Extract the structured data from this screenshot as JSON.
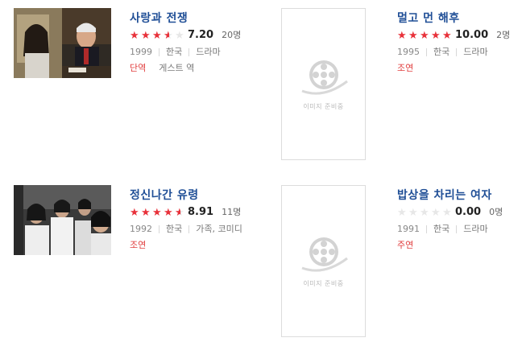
{
  "filmography": [
    {
      "title": "사랑과 전쟁",
      "stars": [
        1,
        1,
        1,
        0.5,
        0
      ],
      "score": "7.20",
      "count": "20명",
      "year": "1999",
      "country": "한국",
      "genre": "드라마",
      "role": "단역",
      "role_extra": "게스트 역",
      "has_image": true
    },
    {
      "title": "멀고 먼 해후",
      "stars": [
        1,
        1,
        1,
        1,
        1
      ],
      "score": "10.00",
      "count": "2명",
      "year": "1995",
      "country": "한국",
      "genre": "드라마",
      "role": "조연",
      "role_extra": "",
      "has_image": false
    },
    {
      "title": "정신나간 유령",
      "stars": [
        1,
        1,
        1,
        1,
        0.5
      ],
      "score": "8.91",
      "count": "11명",
      "year": "1992",
      "country": "한국",
      "genre": "가족, 코미디",
      "role": "조연",
      "role_extra": "",
      "has_image": true
    },
    {
      "title": "밥상을 차리는 여자",
      "stars": [
        0,
        0,
        0,
        0,
        0
      ],
      "score": "0.00",
      "count": "0명",
      "year": "1991",
      "country": "한국",
      "genre": "드라마",
      "role": "주연",
      "role_extra": "",
      "has_image": false
    }
  ],
  "placeholder_text": "이미지 준비중",
  "colors": {
    "title": "#1f4e96",
    "star_on": "#e8313a",
    "star_off": "#e7e7e7",
    "role": "#e03c3c"
  }
}
